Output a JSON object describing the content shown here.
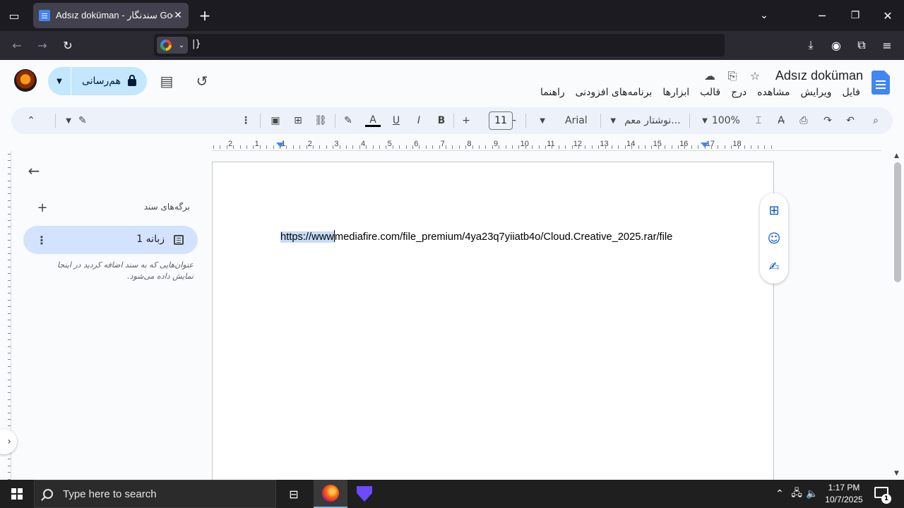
{
  "browser": {
    "tab_title": "Adsız doküman - سندنگار Google",
    "url_text": "|}",
    "icons": [
      "tab-list-icon",
      "new-tab-icon",
      "back-icon",
      "forward-icon",
      "reload-icon",
      "google-engine-icon",
      "download-icon",
      "account-icon",
      "extensions-icon",
      "menu-icon",
      "minimize-icon",
      "maximize-icon",
      "close-icon"
    ]
  },
  "docs": {
    "title": "Adsız doküman",
    "menu": [
      "فایل",
      "ویرایش",
      "مشاهده",
      "درج",
      "قالب",
      "ابزارها",
      "برنامه‌های افزودنی",
      "راهنما"
    ],
    "share_label": "هم‌رسانی",
    "accent": "#c2e7ff"
  },
  "toolbar": {
    "zoom": "100%",
    "style": "نوشتار معم...",
    "font": "Arial",
    "font_size": "11"
  },
  "ruler": {
    "numbers": [
      "2",
      "1",
      "1",
      "2",
      "3",
      "4",
      "5",
      "6",
      "7",
      "8",
      "9",
      "10",
      "11",
      "12",
      "13",
      "14",
      "15",
      "16",
      "17",
      "18"
    ]
  },
  "sidebar": {
    "tabs_label": "برگه‌های سند",
    "tab_name": "زبانه 1",
    "hint": "عنوان‌هایی که به سند اضافه کردید در اینجا نمایش داده می‌شود."
  },
  "document": {
    "selected_text": "https://www",
    "rest_text": "mediafire.com/file_premium/4ya23q7yiiatb4o/Cloud.Creative_2025.rar/file"
  },
  "taskbar": {
    "search_placeholder": "Type here to search",
    "time": "1:17 PM",
    "date": "10/7/2025",
    "notification_count": "1"
  }
}
